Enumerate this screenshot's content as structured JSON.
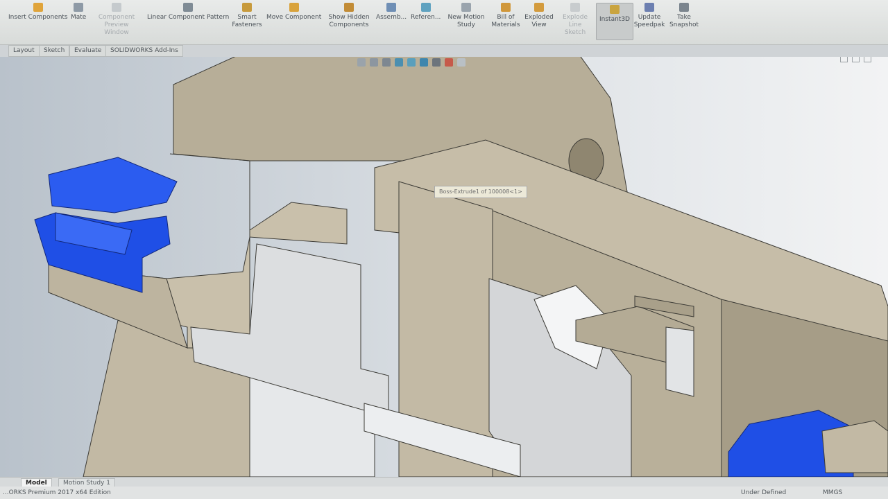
{
  "ribbon": {
    "buttons": [
      {
        "label": "Insert Components",
        "icon": "insert-components-icon"
      },
      {
        "label": "Mate",
        "icon": "mate-icon"
      },
      {
        "label": "Component Preview Window",
        "icon": "component-preview-icon"
      },
      {
        "label": "Linear Component Pattern",
        "icon": "linear-pattern-icon"
      },
      {
        "label": "Smart Fasteners",
        "icon": "smart-fasteners-icon"
      },
      {
        "label": "Move Component",
        "icon": "move-component-icon"
      },
      {
        "label": "Show Hidden Components",
        "icon": "show-hidden-icon"
      },
      {
        "label": "Assemb...",
        "icon": "assembly-features-icon"
      },
      {
        "label": "Referen...",
        "icon": "reference-geometry-icon"
      },
      {
        "label": "New Motion Study",
        "icon": "motion-study-icon"
      },
      {
        "label": "Bill of Materials",
        "icon": "bom-icon"
      },
      {
        "label": "Exploded View",
        "icon": "exploded-view-icon"
      },
      {
        "label": "Explode Line Sketch",
        "icon": "explode-line-icon"
      },
      {
        "label": "Instant3D",
        "icon": "instant3d-icon"
      },
      {
        "label": "Update Speedpak",
        "icon": "speedpak-icon"
      },
      {
        "label": "Take Snapshot",
        "icon": "snapshot-icon"
      }
    ]
  },
  "command_tabs": [
    "Layout",
    "Sketch",
    "Evaluate",
    "SOLIDWORKS Add-Ins"
  ],
  "viewport": {
    "tooltip": "Boss-Extrude1 of 100008<1>",
    "colors": {
      "part": "#c4bba6",
      "part_dark": "#a0977f",
      "blue": "#1f4fe6",
      "cavity": "#e4e6e8"
    }
  },
  "bottom_tabs": [
    "Model",
    "Motion Study 1"
  ],
  "status": {
    "edition": "...ORKS Premium 2017 x64 Edition",
    "state": "Under Defined",
    "units": "MMGS"
  }
}
